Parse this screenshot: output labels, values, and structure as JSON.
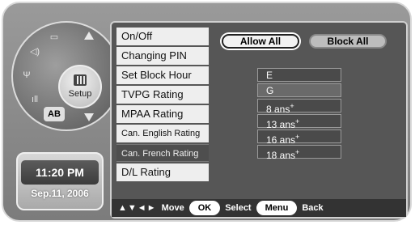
{
  "dial": {
    "setup_label": "Setup",
    "segments": [
      {
        "icon": "picture-icon"
      },
      {
        "icon": "speaker-icon"
      },
      {
        "icon": "antenna-icon"
      },
      {
        "icon": "signal-icon"
      },
      {
        "label": "AB"
      }
    ]
  },
  "clock": {
    "time": "11:20 PM",
    "date": "Sep.11, 2006"
  },
  "menu": {
    "items": [
      {
        "label": "On/Off"
      },
      {
        "label": "Changing PIN"
      },
      {
        "label": "Set Block Hour"
      },
      {
        "label": "TVPG Rating"
      },
      {
        "label": "MPAA Rating"
      },
      {
        "label": "Can. English Rating"
      },
      {
        "label": "Can. French Rating"
      },
      {
        "label": "D/L Rating"
      }
    ]
  },
  "actions": {
    "allow_all": "Allow All",
    "block_all": "Block All"
  },
  "ratings": [
    {
      "label": "E",
      "sup": ""
    },
    {
      "label": "G",
      "sup": ""
    },
    {
      "label": "8 ans",
      "sup": "+"
    },
    {
      "label": "13 ans",
      "sup": "+"
    },
    {
      "label": "16 ans",
      "sup": "+"
    },
    {
      "label": "18 ans",
      "sup": "+"
    }
  ],
  "help": {
    "nav_arrows": "▲▼◄►",
    "move": "Move",
    "ok_key": "OK",
    "select": "Select",
    "menu_key": "Menu",
    "back": "Back"
  },
  "colors": {
    "panel": "#565656",
    "menu_item": "#eeeeee",
    "selected_item": "#4e4e4e"
  }
}
